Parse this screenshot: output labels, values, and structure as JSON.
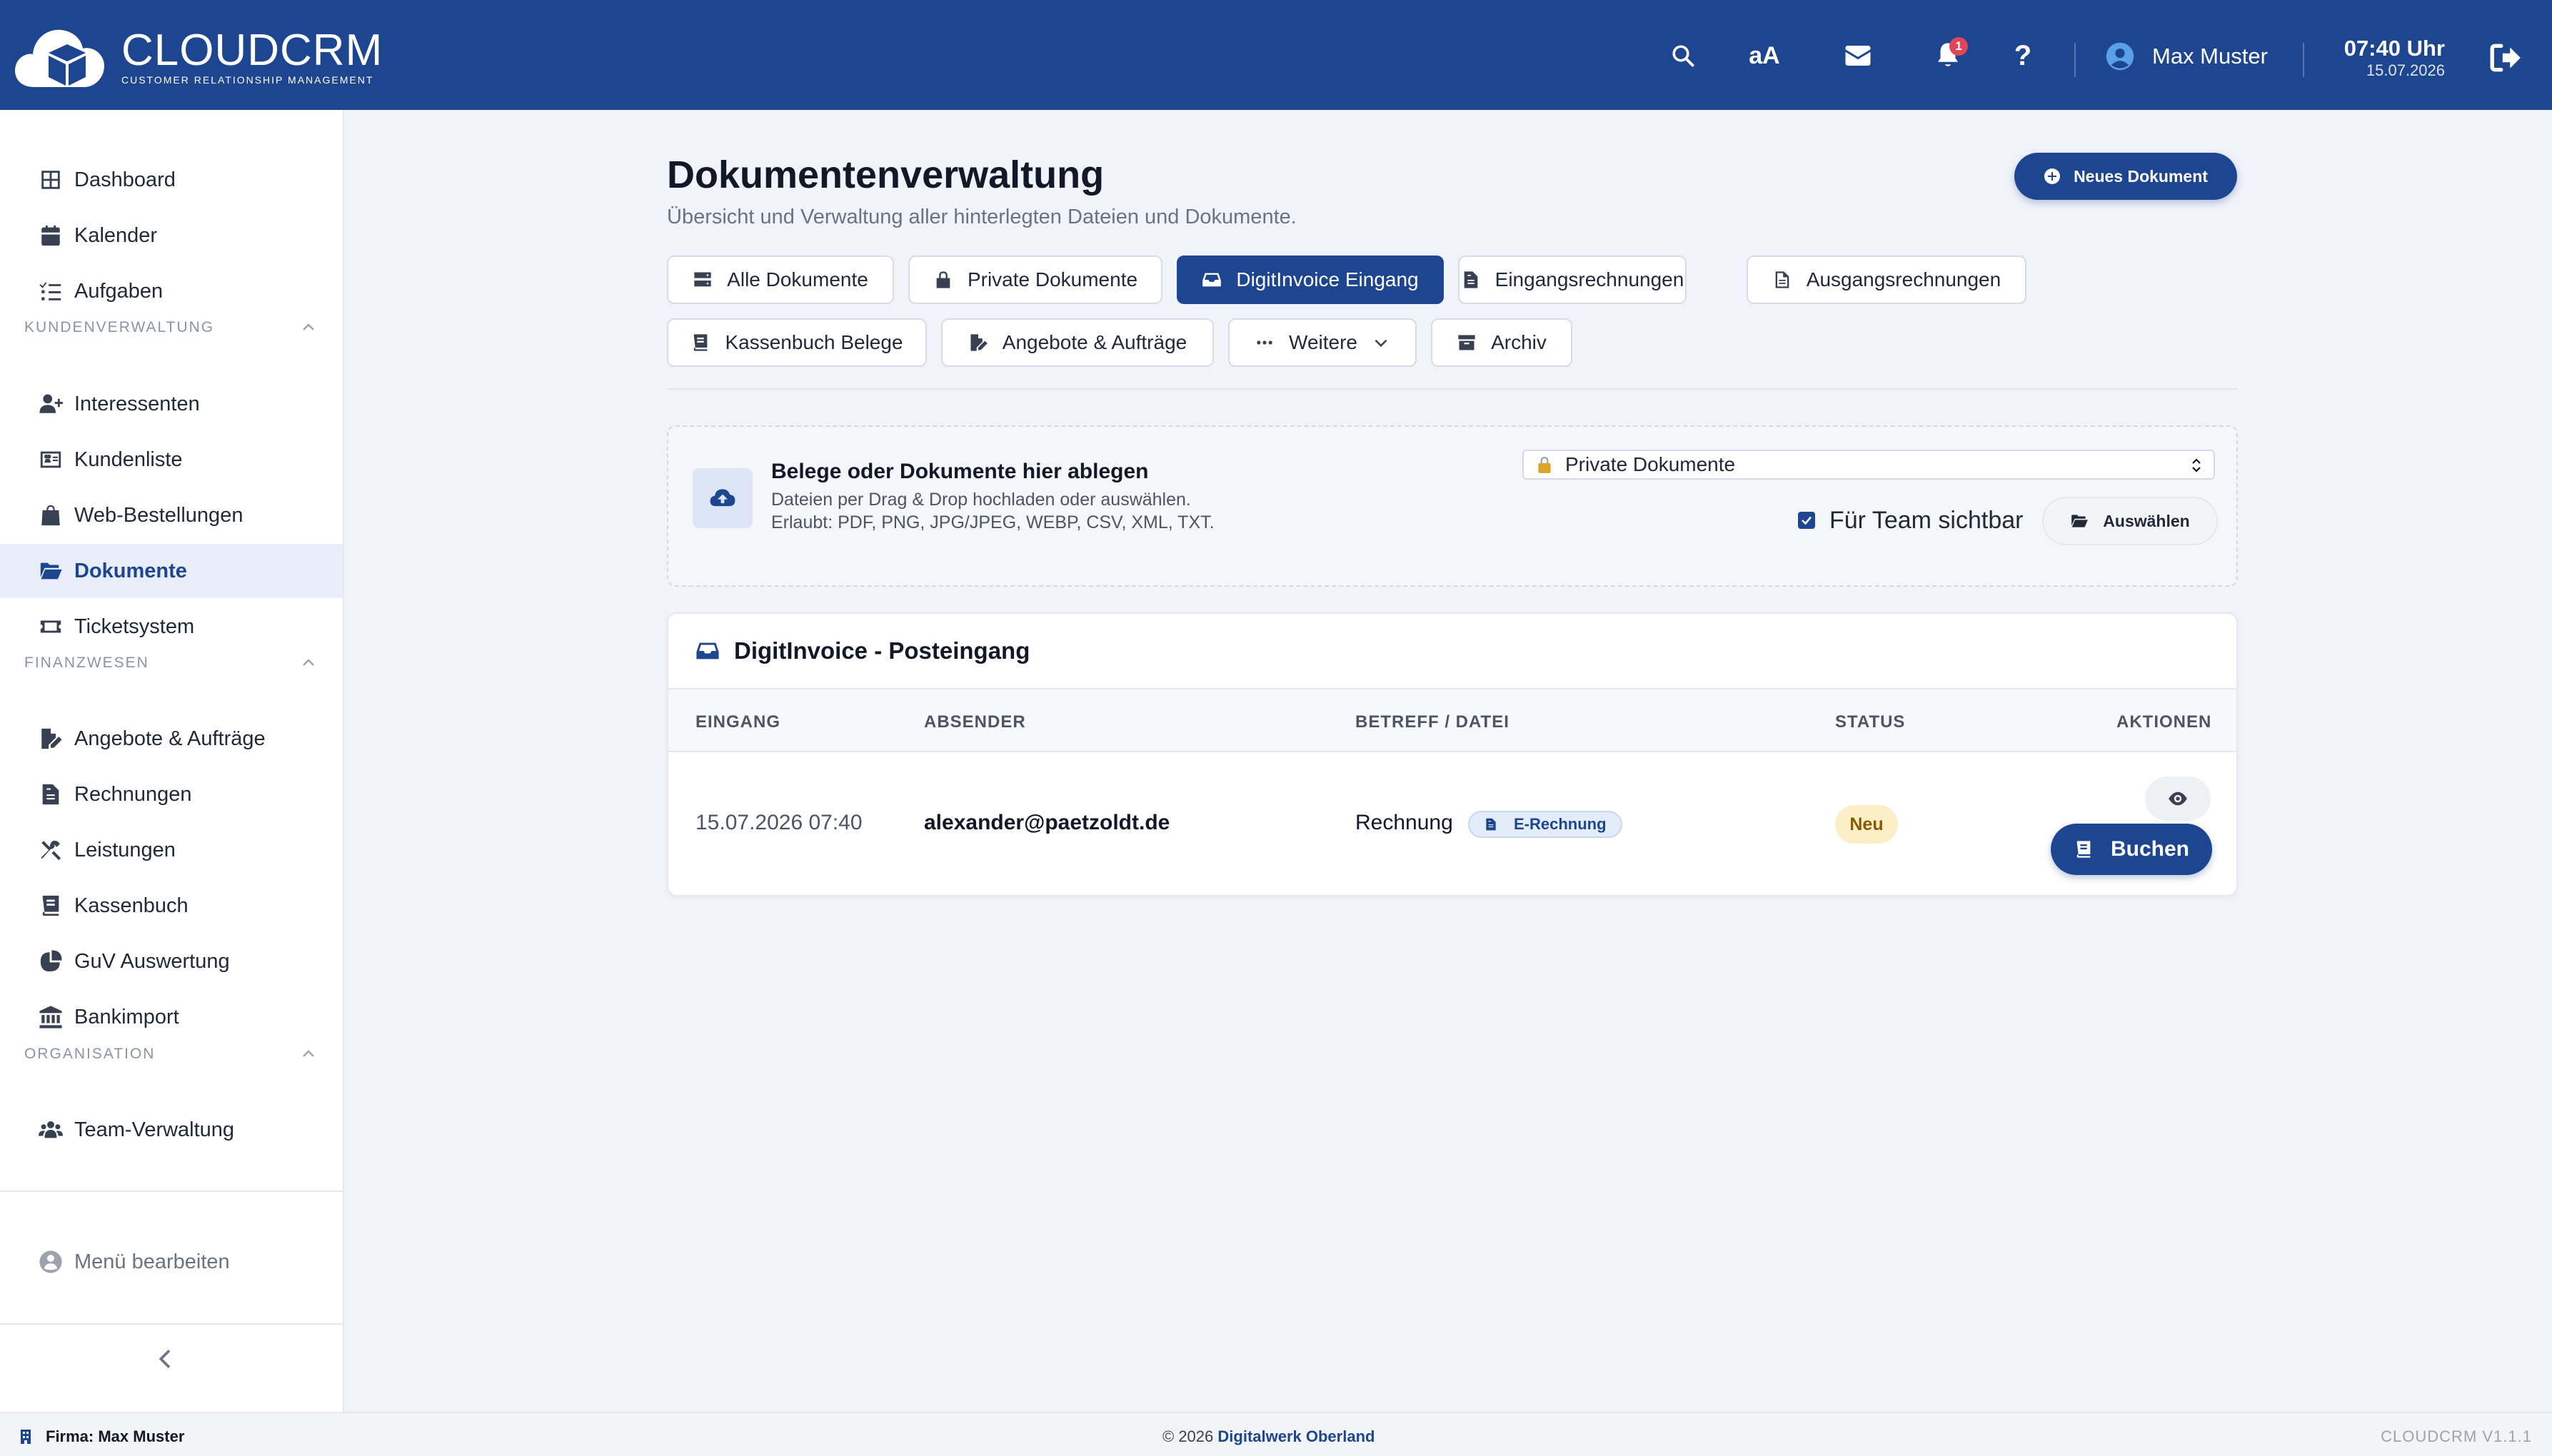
{
  "app": {
    "logo_name": "CLOUDCRM",
    "logo_tagline": "CUSTOMER RELATIONSHIP MANAGEMENT",
    "font_size_toggle": "aA",
    "help_label": "?",
    "notification_count": "1",
    "user_name": "Max Muster",
    "time": "07:40 Uhr",
    "date": "15.07.2026",
    "brand_color": "#1e4590"
  },
  "sidebar": {
    "items_top": [
      {
        "label": "Dashboard",
        "icon": "grid-icon"
      },
      {
        "label": "Kalender",
        "icon": "calendar-icon"
      },
      {
        "label": "Aufgaben",
        "icon": "task-list-icon"
      }
    ],
    "section_customers": "KUNDENVERWALTUNG",
    "items_customers": [
      {
        "label": "Interessenten",
        "icon": "user-plus-icon"
      },
      {
        "label": "Kundenliste",
        "icon": "address-card-icon"
      },
      {
        "label": "Web-Bestellungen",
        "icon": "shopping-bag-icon"
      },
      {
        "label": "Dokumente",
        "icon": "folder-open-icon",
        "active": true
      },
      {
        "label": "Ticketsystem",
        "icon": "ticket-icon"
      }
    ],
    "section_finance": "FINANZWESEN",
    "items_finance": [
      {
        "label": "Angebote & Aufträge",
        "icon": "file-signature-icon"
      },
      {
        "label": "Rechnungen",
        "icon": "invoice-icon"
      },
      {
        "label": "Leistungen",
        "icon": "tools-icon"
      },
      {
        "label": "Kassenbuch",
        "icon": "book-icon"
      },
      {
        "label": "GuV Auswertung",
        "icon": "pie-chart-icon"
      },
      {
        "label": "Bankimport",
        "icon": "bank-icon"
      }
    ],
    "section_org": "ORGANISATION",
    "items_org": [
      {
        "label": "Team-Verwaltung",
        "icon": "users-icon"
      }
    ],
    "menu_edit": "Menü bearbeiten"
  },
  "main": {
    "title": "Dokumentenverwaltung",
    "subtitle": "Übersicht und Verwaltung aller hinterlegten Dateien und Dokumente.",
    "new_doc_button": "Neues Dokument",
    "tabs": [
      {
        "label": "Alle Dokumente",
        "icon": "server-icon"
      },
      {
        "label": "Private Dokumente",
        "icon": "lock-icon"
      },
      {
        "label": "DigitInvoice Eingang",
        "icon": "inbox-icon",
        "active": true
      },
      {
        "label": "Eingangsrechnungen",
        "icon": "invoice-icon"
      },
      {
        "label": "Ausgangsrechnungen",
        "icon": "file-icon"
      },
      {
        "label": "Kassenbuch Belege",
        "icon": "book-icon"
      },
      {
        "label": "Angebote & Aufträge",
        "icon": "file-signature-icon"
      },
      {
        "label": "Weitere",
        "icon": "ellipsis-icon"
      },
      {
        "label": "Archiv",
        "icon": "archive-icon"
      }
    ],
    "upload": {
      "title": "Belege oder Dokumente hier ablegen",
      "line1": "Dateien per Drag & Drop hochladen oder auswählen.",
      "line2": "Erlaubt: PDF, PNG, JPG/JPEG, WEBP, CSV, XML, TXT.",
      "target_select": "Private Dokumente",
      "team_visible_label": "Für Team sichtbar",
      "team_visible_checked": true,
      "choose_button": "Auswählen"
    },
    "inbox": {
      "title": "DigitInvoice - Posteingang",
      "columns": [
        "EINGANG",
        "ABSENDER",
        "BETREFF / DATEI",
        "STATUS",
        "AKTIONEN"
      ],
      "rows": [
        {
          "received": "15.07.2026 07:40",
          "sender": "alexander@paetzoldt.de",
          "subject": "Rechnung",
          "tag": "E-Rechnung",
          "status": "Neu",
          "book_button": "Buchen"
        }
      ]
    }
  },
  "footer": {
    "company": "Firma: Max Muster",
    "copyright": "© 2026",
    "company_link": "Digitalwerk Oberland",
    "version": "CLOUDCRM V1.1.1"
  }
}
